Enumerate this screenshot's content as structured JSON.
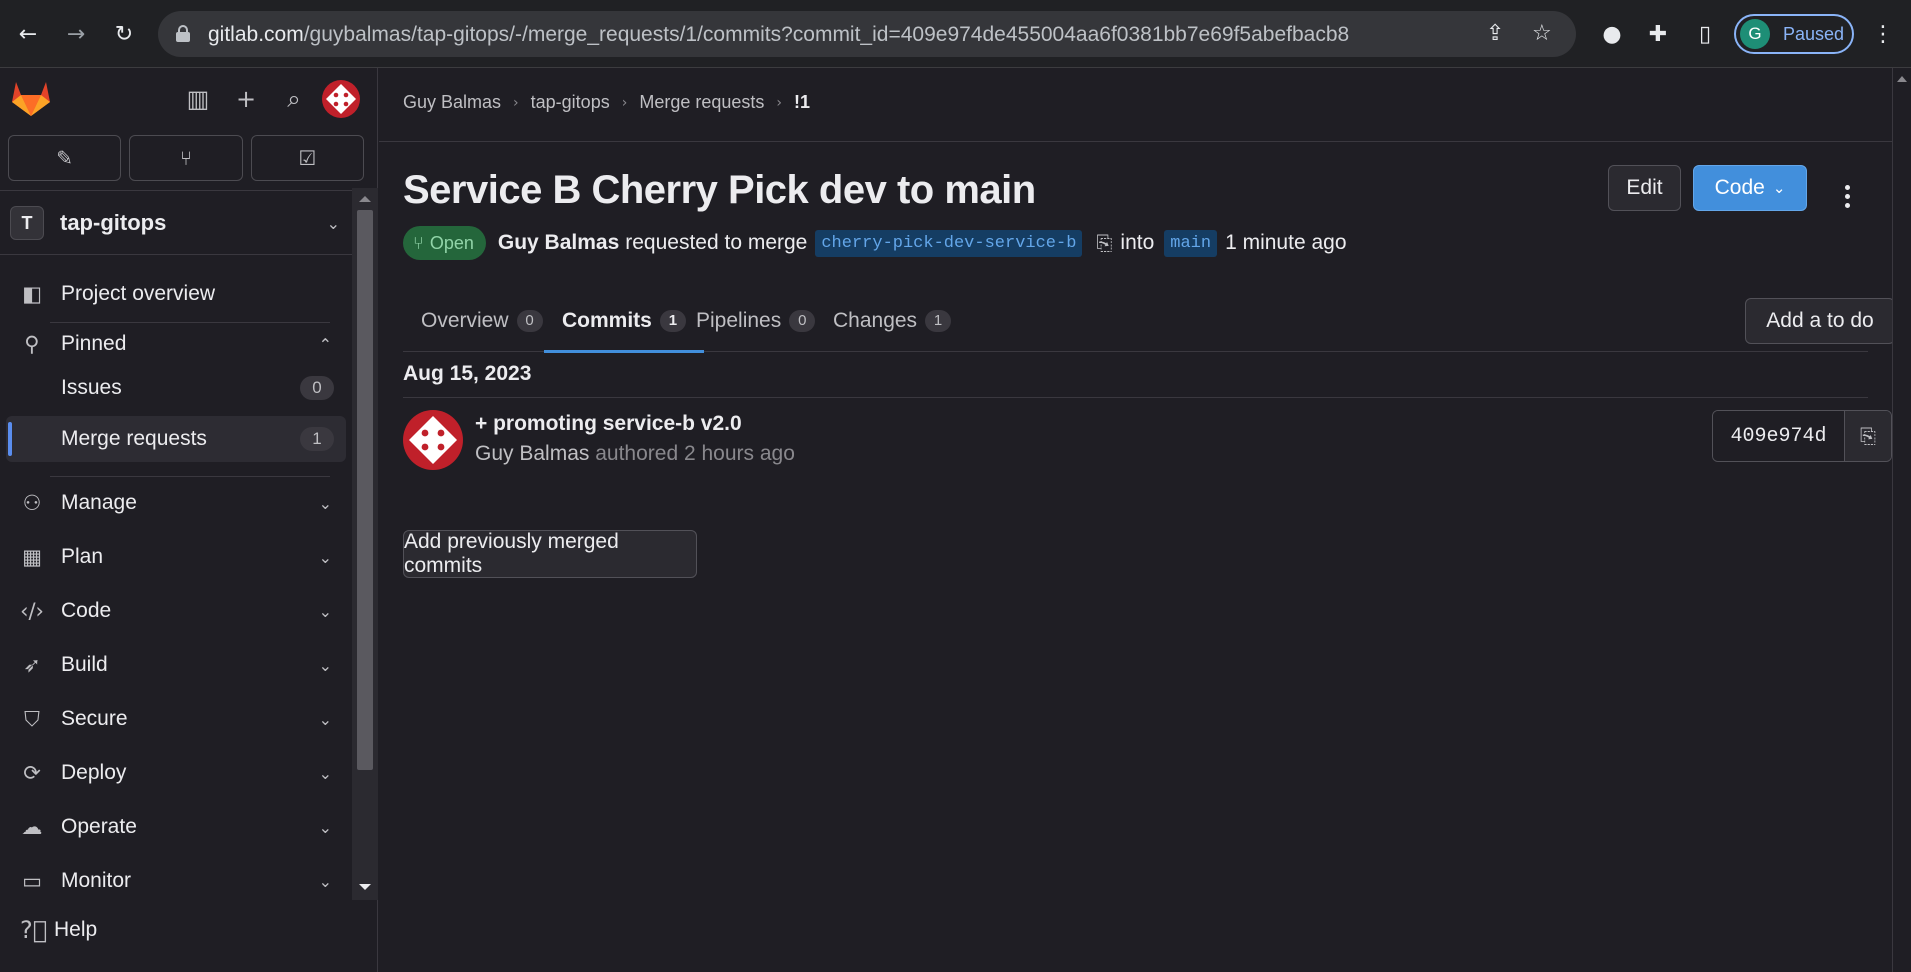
{
  "browser": {
    "url_host": "gitlab.com",
    "url_path": "/guybalmas/tap-gitops/-/merge_requests/1/commits?commit_id=409e974de455004aa6f0381bb7e69f5abefbacb8",
    "profile_initial": "G",
    "profile_status": "Paused"
  },
  "sidebar": {
    "project_initial": "T",
    "project_name": "tap-gitops",
    "items": [
      {
        "label": "Project overview"
      },
      {
        "label": "Pinned"
      },
      {
        "label": "Issues",
        "count": "0"
      },
      {
        "label": "Merge requests",
        "count": "1"
      },
      {
        "label": "Manage"
      },
      {
        "label": "Plan"
      },
      {
        "label": "Code"
      },
      {
        "label": "Build"
      },
      {
        "label": "Secure"
      },
      {
        "label": "Deploy"
      },
      {
        "label": "Operate"
      },
      {
        "label": "Monitor"
      }
    ],
    "help": "Help"
  },
  "breadcrumb": [
    "Guy Balmas",
    "tap-gitops",
    "Merge requests",
    "!1"
  ],
  "mr": {
    "title": "Service B Cherry Pick dev to main",
    "status": "Open",
    "author": "Guy Balmas",
    "requested_text": "requested to merge",
    "source_branch": "cherry-pick-dev-service-b",
    "into_text": "into",
    "target_branch": "main",
    "time": "1 minute ago",
    "edit_label": "Edit",
    "code_label": "Code"
  },
  "tabs": [
    {
      "label": "Overview",
      "count": "0"
    },
    {
      "label": "Commits",
      "count": "1"
    },
    {
      "label": "Pipelines",
      "count": "0"
    },
    {
      "label": "Changes",
      "count": "1"
    }
  ],
  "add_todo_label": "Add a to do",
  "commits": {
    "date": "Aug 15, 2023",
    "items": [
      {
        "title": "+ promoting service-b v2.0",
        "author": "Guy Balmas",
        "meta": "authored 2 hours ago",
        "sha": "409e974d"
      }
    ]
  },
  "add_merged_label": "Add previously merged commits"
}
